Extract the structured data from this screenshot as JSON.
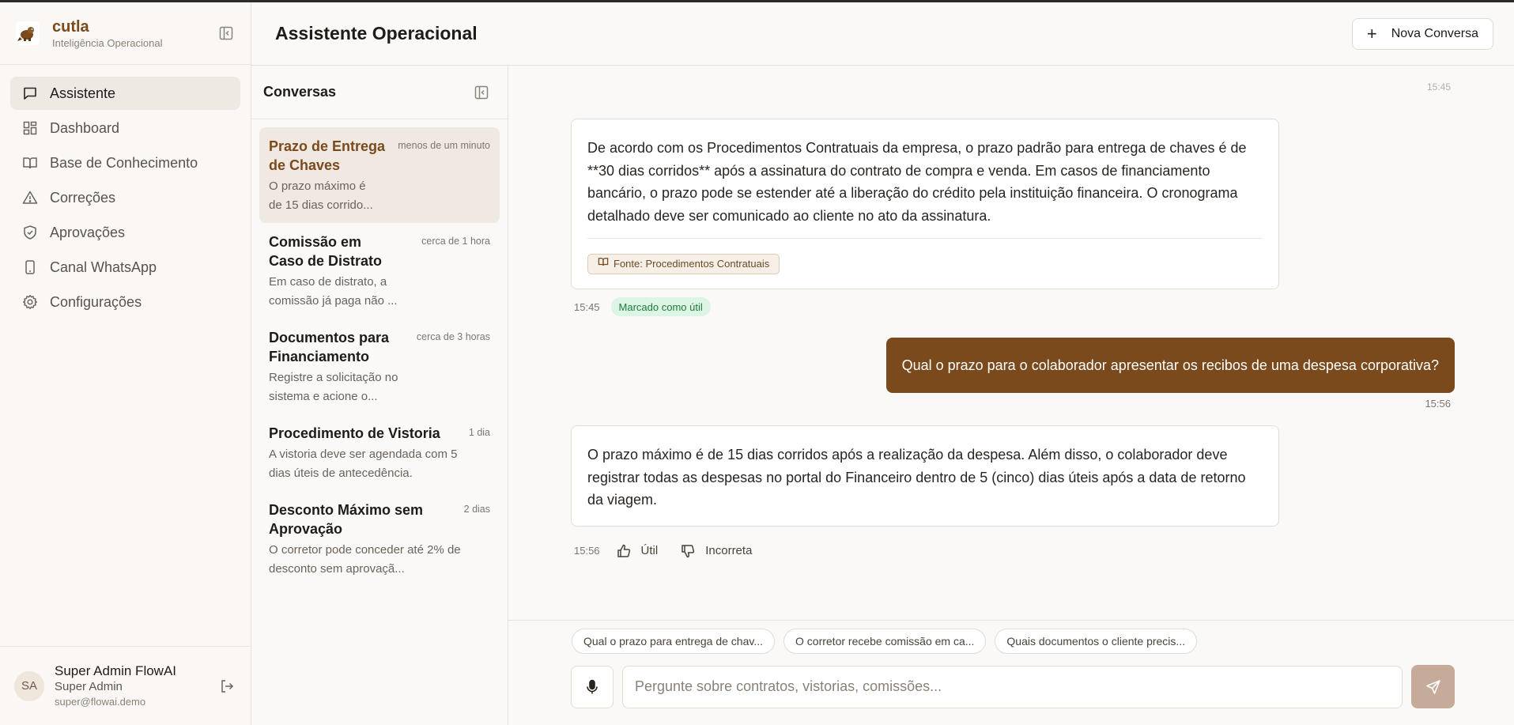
{
  "brand": {
    "name": "cutla",
    "subtitle": "Inteligência Operacional"
  },
  "nav": [
    {
      "label": "Assistente",
      "icon": "message-square-icon",
      "active": true
    },
    {
      "label": "Dashboard",
      "icon": "layout-dashboard-icon"
    },
    {
      "label": "Base de Conhecimento",
      "icon": "book-open-icon"
    },
    {
      "label": "Correções",
      "icon": "alert-triangle-icon"
    },
    {
      "label": "Aprovações",
      "icon": "shield-check-icon"
    },
    {
      "label": "Canal WhatsApp",
      "icon": "smartphone-icon"
    },
    {
      "label": "Configurações",
      "icon": "settings-icon"
    }
  ],
  "user": {
    "initials": "SA",
    "name": "Super Admin FlowAI",
    "role": "Super Admin",
    "email": "super@flowai.demo"
  },
  "header": {
    "title": "Assistente Operacional",
    "new_button": "Nova Conversa"
  },
  "conversations": {
    "title": "Conversas",
    "items": [
      {
        "title": "Prazo de Entrega de Chaves",
        "time": "menos de um minuto",
        "snippet": "O prazo máximo é de 15 dias corrido...",
        "active": true
      },
      {
        "title": "Comissão em Caso de Distrato",
        "time": "cerca de 1 hora",
        "snippet": "Em caso de distrato, a comissão já paga não ..."
      },
      {
        "title": "Documentos para Financiamento",
        "time": "cerca de 3 horas",
        "snippet": "Registre a solicitação no sistema e acione o..."
      },
      {
        "title": "Procedimento de Vistoria",
        "time": "1 dia",
        "snippet": "A vistoria deve ser agendada com 5 dias úteis de antecedência."
      },
      {
        "title": "Desconto Máximo sem Aprovação",
        "time": "2 dias",
        "snippet": "O corretor pode conceder até 2% de desconto sem aprovaçã..."
      }
    ]
  },
  "chat": {
    "faded_time": "15:45",
    "message1": {
      "text": "De acordo com os Procedimentos Contratuais da empresa, o prazo padrão para entrega de chaves é de **30 dias corridos** após a assinatura do contrato de compra e venda. Em casos de financiamento bancário, o prazo pode se estender até a liberação do crédito pela instituição financeira. O cronograma detalhado deve ser comunicado ao cliente no ato da assinatura.",
      "source": "Fonte: Procedimentos Contratuais",
      "time": "15:45",
      "badge": "Marcado como útil"
    },
    "user_message": {
      "text": "Qual o prazo para o colaborador apresentar os recibos de uma despesa corporativa?",
      "time": "15:56"
    },
    "message3": {
      "text": "O prazo máximo é de 15 dias corridos após a realização da despesa. Além disso, o colaborador deve registrar todas as despesas no portal do Financeiro dentro de 5 (cinco) dias úteis após a data de retorno da viagem.",
      "time": "15:56",
      "useful_label": "Útil",
      "incorrect_label": "Incorreta"
    }
  },
  "composer": {
    "suggestions": [
      "Qual o prazo para entrega de chav...",
      "O corretor recebe comissão em ca...",
      "Quais documentos o cliente precis..."
    ],
    "placeholder": "Pergunte sobre contratos, vistorias, comissões..."
  },
  "colors": {
    "accent": "#7a4a1c",
    "send_button": "#c6ac98",
    "useful_badge_bg": "#dcf5e4"
  }
}
